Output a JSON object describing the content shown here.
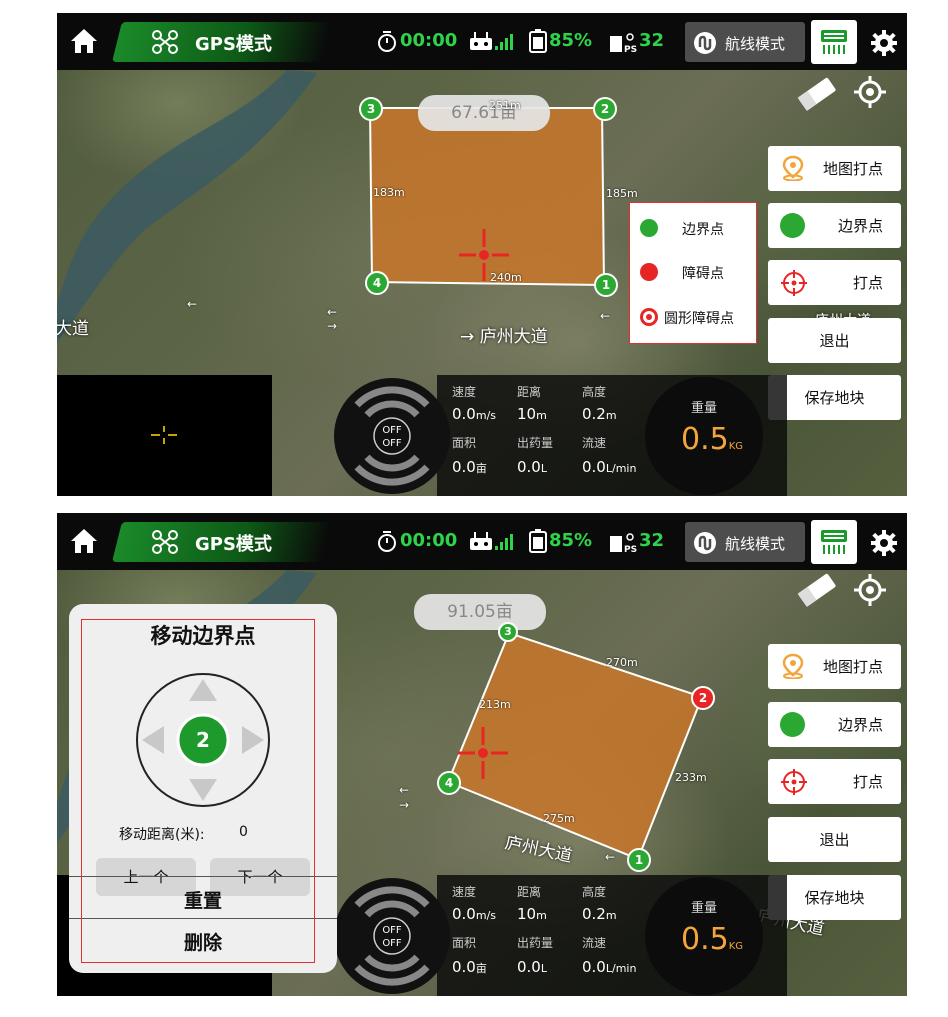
{
  "topbar": {
    "mode": "GPS模式",
    "timer": "00:00",
    "battery": "85%",
    "gps_count": "32",
    "route_mode": "航线模式"
  },
  "screen1": {
    "area": "67.61亩",
    "vertices": [
      "1",
      "2",
      "3",
      "4"
    ],
    "edges": {
      "top": "251m",
      "left": "183m",
      "right": "185m",
      "bottom": "240m"
    },
    "road": "庐州大道",
    "road_left": "大道",
    "road_right": "庐州大道",
    "legend": [
      {
        "label": "边界点",
        "color": "#2aa832"
      },
      {
        "label": "障碍点",
        "color": "#e82525"
      },
      {
        "label": "圆形障碍点",
        "color": "#e82525"
      }
    ]
  },
  "screen2": {
    "area": "91.05亩",
    "vertices": [
      "1",
      "2",
      "3",
      "4"
    ],
    "edges": {
      "top": "270m",
      "left": "213m",
      "right": "233m",
      "bottom": "275m"
    },
    "road": "庐州大道",
    "road_right": "庐州大道",
    "panel": {
      "title": "移动边界点",
      "point": "2",
      "distance_label": "移动距离(米):",
      "distance_value": "0",
      "prev": "上一个",
      "next": "下一个",
      "reset": "重置",
      "delete": "删除"
    }
  },
  "right_buttons": {
    "map_point": "地图打点",
    "boundary": "边界点",
    "mark_point": "打点",
    "exit": "退出",
    "save": "保存地块"
  },
  "telemetry": {
    "labels": [
      "速度",
      "距离",
      "高度",
      "面积",
      "出药量",
      "流速"
    ],
    "values": [
      "0.0",
      "10",
      "0.2",
      "0.0",
      "0.0",
      "0.0"
    ],
    "units": [
      "m/s",
      "m",
      "m",
      "亩",
      "L",
      "L/min"
    ],
    "joy_off": [
      "OFF",
      "OFF"
    ],
    "weight_label": "重量",
    "weight_value": "0.5",
    "weight_unit": "KG"
  }
}
